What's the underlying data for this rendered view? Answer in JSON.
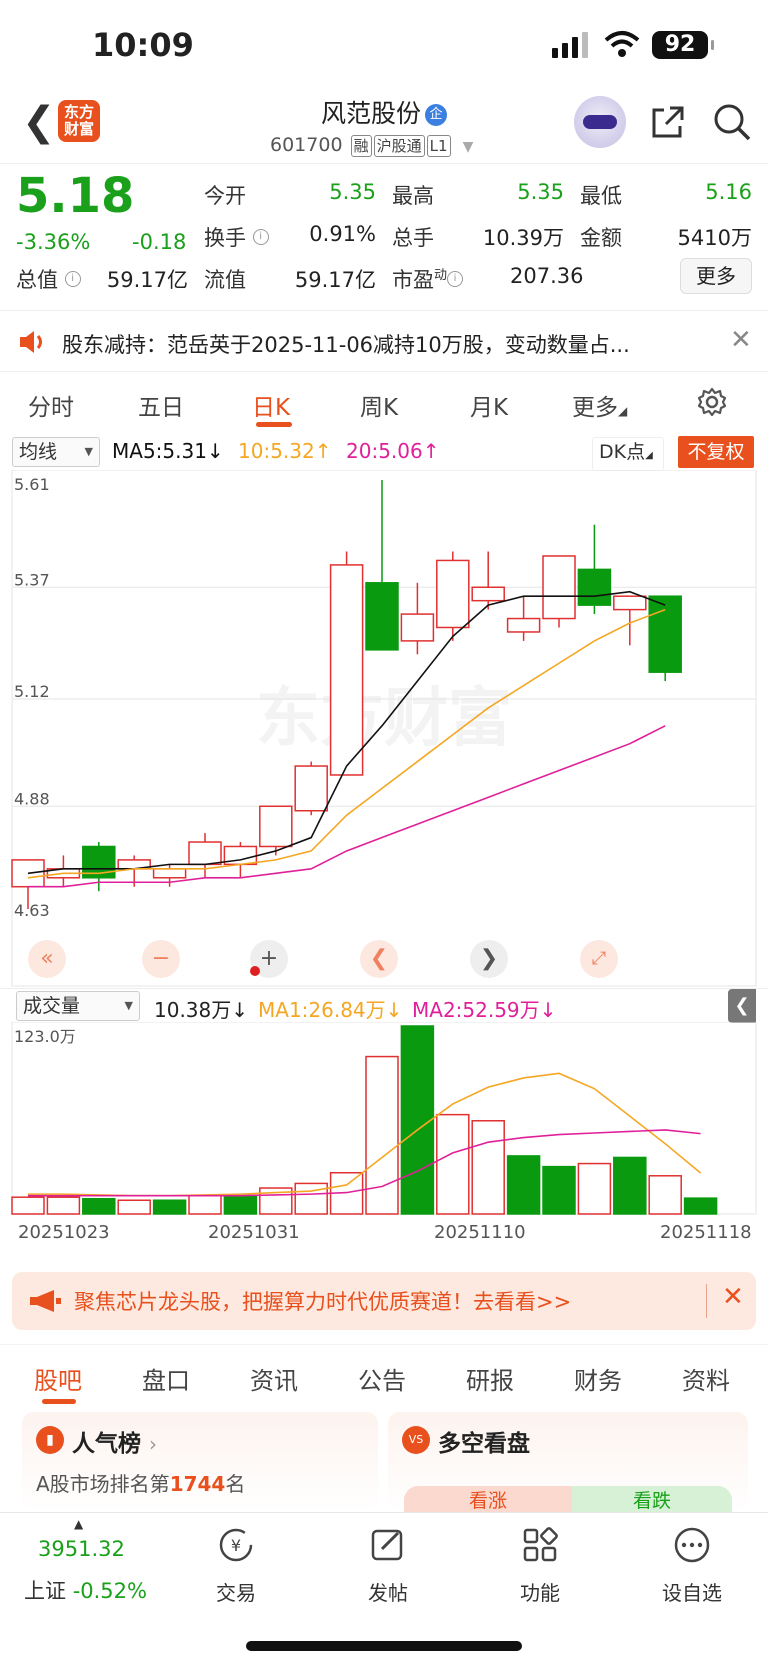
{
  "status": {
    "time": "10:09",
    "battery": "92"
  },
  "header": {
    "logo": "东方财富",
    "name": "风范股份",
    "qi": "企",
    "code": "601700",
    "tags": [
      "融",
      "沪股通",
      "L1"
    ]
  },
  "quote": {
    "price": "5.18",
    "pct": "-3.36%",
    "chg": "-0.18",
    "labels": {
      "open": "今开",
      "high": "最高",
      "low": "最低",
      "turnover": "换手",
      "vol": "总手",
      "amount": "金额",
      "mktcap": "总值",
      "float": "流值",
      "pe": "市盈"
    },
    "values": {
      "open": "5.35",
      "high": "5.35",
      "low": "5.16",
      "turnover": "0.91%",
      "vol": "10.39万",
      "amount": "5410万",
      "mktcap": "59.17亿",
      "float": "59.17亿",
      "pe": "207.36"
    },
    "pe_sup": "动",
    "more": "更多"
  },
  "notice": {
    "text": "股东减持：范岳英于2025-11-06减持10万股，变动数量占..."
  },
  "tabs": [
    "分时",
    "五日",
    "日K",
    "周K",
    "月K",
    "更多"
  ],
  "ma_bar": {
    "select": "均线",
    "ma5": "MA5:5.31↓",
    "ma10": "10:5.32↑",
    "ma20": "20:5.06↑",
    "dk": "DK点",
    "fq": "不复权"
  },
  "colors": {
    "up": "#e03030",
    "down": "#0a9a10",
    "ma5": "#111111",
    "ma10": "#f5a623",
    "ma20": "#e0209a",
    "accent": "#e8501e"
  },
  "vol_bar": {
    "select": "成交量",
    "vol": "10.38万↓",
    "ma1": "MA1:26.84万↓",
    "ma2": "MA2:52.59万↓"
  },
  "chart_data": [
    {
      "type": "candlestick",
      "y_ticks": [
        "5.61",
        "5.37",
        "5.12",
        "4.88",
        "4.63"
      ],
      "ylim": [
        4.63,
        5.61
      ],
      "candles": [
        {
          "o": 4.7,
          "h": 4.76,
          "l": 4.65,
          "c": 4.76
        },
        {
          "o": 4.72,
          "h": 4.77,
          "l": 4.7,
          "c": 4.74
        },
        {
          "o": 4.79,
          "h": 4.8,
          "l": 4.69,
          "c": 4.72
        },
        {
          "o": 4.74,
          "h": 4.77,
          "l": 4.7,
          "c": 4.76
        },
        {
          "o": 4.72,
          "h": 4.75,
          "l": 4.7,
          "c": 4.74
        },
        {
          "o": 4.75,
          "h": 4.82,
          "l": 4.72,
          "c": 4.8
        },
        {
          "o": 4.75,
          "h": 4.8,
          "l": 4.72,
          "c": 4.79
        },
        {
          "o": 4.79,
          "h": 4.88,
          "l": 4.77,
          "c": 4.88
        },
        {
          "o": 4.87,
          "h": 4.98,
          "l": 4.86,
          "c": 4.97
        },
        {
          "o": 4.95,
          "h": 5.45,
          "l": 4.95,
          "c": 5.42
        },
        {
          "o": 5.38,
          "h": 5.61,
          "l": 5.33,
          "c": 5.23
        },
        {
          "o": 5.25,
          "h": 5.38,
          "l": 5.22,
          "c": 5.31
        },
        {
          "o": 5.28,
          "h": 5.45,
          "l": 5.25,
          "c": 5.43
        },
        {
          "o": 5.34,
          "h": 5.45,
          "l": 5.32,
          "c": 5.37
        },
        {
          "o": 5.27,
          "h": 5.35,
          "l": 5.25,
          "c": 5.3
        },
        {
          "o": 5.3,
          "h": 5.39,
          "l": 5.28,
          "c": 5.44
        },
        {
          "o": 5.41,
          "h": 5.51,
          "l": 5.31,
          "c": 5.33
        },
        {
          "o": 5.32,
          "h": 5.35,
          "l": 5.24,
          "c": 5.35
        },
        {
          "o": 5.35,
          "h": 5.35,
          "l": 5.16,
          "c": 5.18
        }
      ],
      "ma5": [
        4.73,
        4.74,
        4.74,
        4.74,
        4.75,
        4.75,
        4.76,
        4.78,
        4.81,
        4.97,
        5.06,
        5.16,
        5.26,
        5.33,
        5.35,
        5.35,
        5.35,
        5.36,
        5.33
      ],
      "ma10": [
        4.72,
        4.73,
        4.73,
        4.74,
        4.74,
        4.74,
        4.75,
        4.76,
        4.78,
        4.86,
        4.92,
        4.98,
        5.04,
        5.1,
        5.15,
        5.2,
        5.25,
        5.29,
        5.32
      ],
      "ma20": [
        4.7,
        4.7,
        4.71,
        4.71,
        4.71,
        4.72,
        4.72,
        4.73,
        4.74,
        4.78,
        4.81,
        4.84,
        4.87,
        4.9,
        4.93,
        4.96,
        4.99,
        5.02,
        5.06
      ]
    },
    {
      "type": "bar",
      "y_tick": "123.0万",
      "ylim": [
        0,
        123
      ],
      "x_ticks": [
        "20251023",
        "20251031",
        "20251110",
        "20251118"
      ],
      "values": [
        11,
        11,
        10,
        9,
        9,
        12,
        12,
        17,
        20,
        27,
        103,
        123,
        65,
        61,
        38,
        31,
        33,
        37,
        25,
        10.38
      ],
      "up": [
        true,
        true,
        false,
        true,
        false,
        true,
        false,
        true,
        true,
        true,
        true,
        false,
        true,
        true,
        false,
        false,
        true,
        false,
        true,
        false
      ],
      "ma1": [
        13,
        13,
        12.5,
        12,
        12,
        12.5,
        13,
        14,
        15,
        19,
        37,
        55,
        72,
        83,
        89,
        92,
        82,
        64,
        46,
        26.84
      ],
      "ma2": [
        12,
        12,
        12,
        12,
        12,
        12,
        12,
        12.5,
        13,
        14,
        18,
        28,
        40,
        47,
        50,
        52,
        53,
        54,
        55,
        52.59
      ]
    }
  ],
  "ad": {
    "text": "聚焦芯片龙头股，把握算力时代优质赛道！去看看>>"
  },
  "tabs2": [
    "股吧",
    "盘口",
    "资讯",
    "公告",
    "研报",
    "财务",
    "资料"
  ],
  "cards": {
    "left_title": "人气榜",
    "left_sub_a": "A股市场排名第",
    "left_rank": "1744",
    "left_sub_b": "名",
    "right_title": "多空看盘",
    "bull": "看涨",
    "bear": "看跌"
  },
  "bottom": {
    "index": "3951.32",
    "index_name": "上证",
    "index_pct": "-0.52%",
    "items": [
      "交易",
      "发帖",
      "功能",
      "设自选"
    ]
  }
}
